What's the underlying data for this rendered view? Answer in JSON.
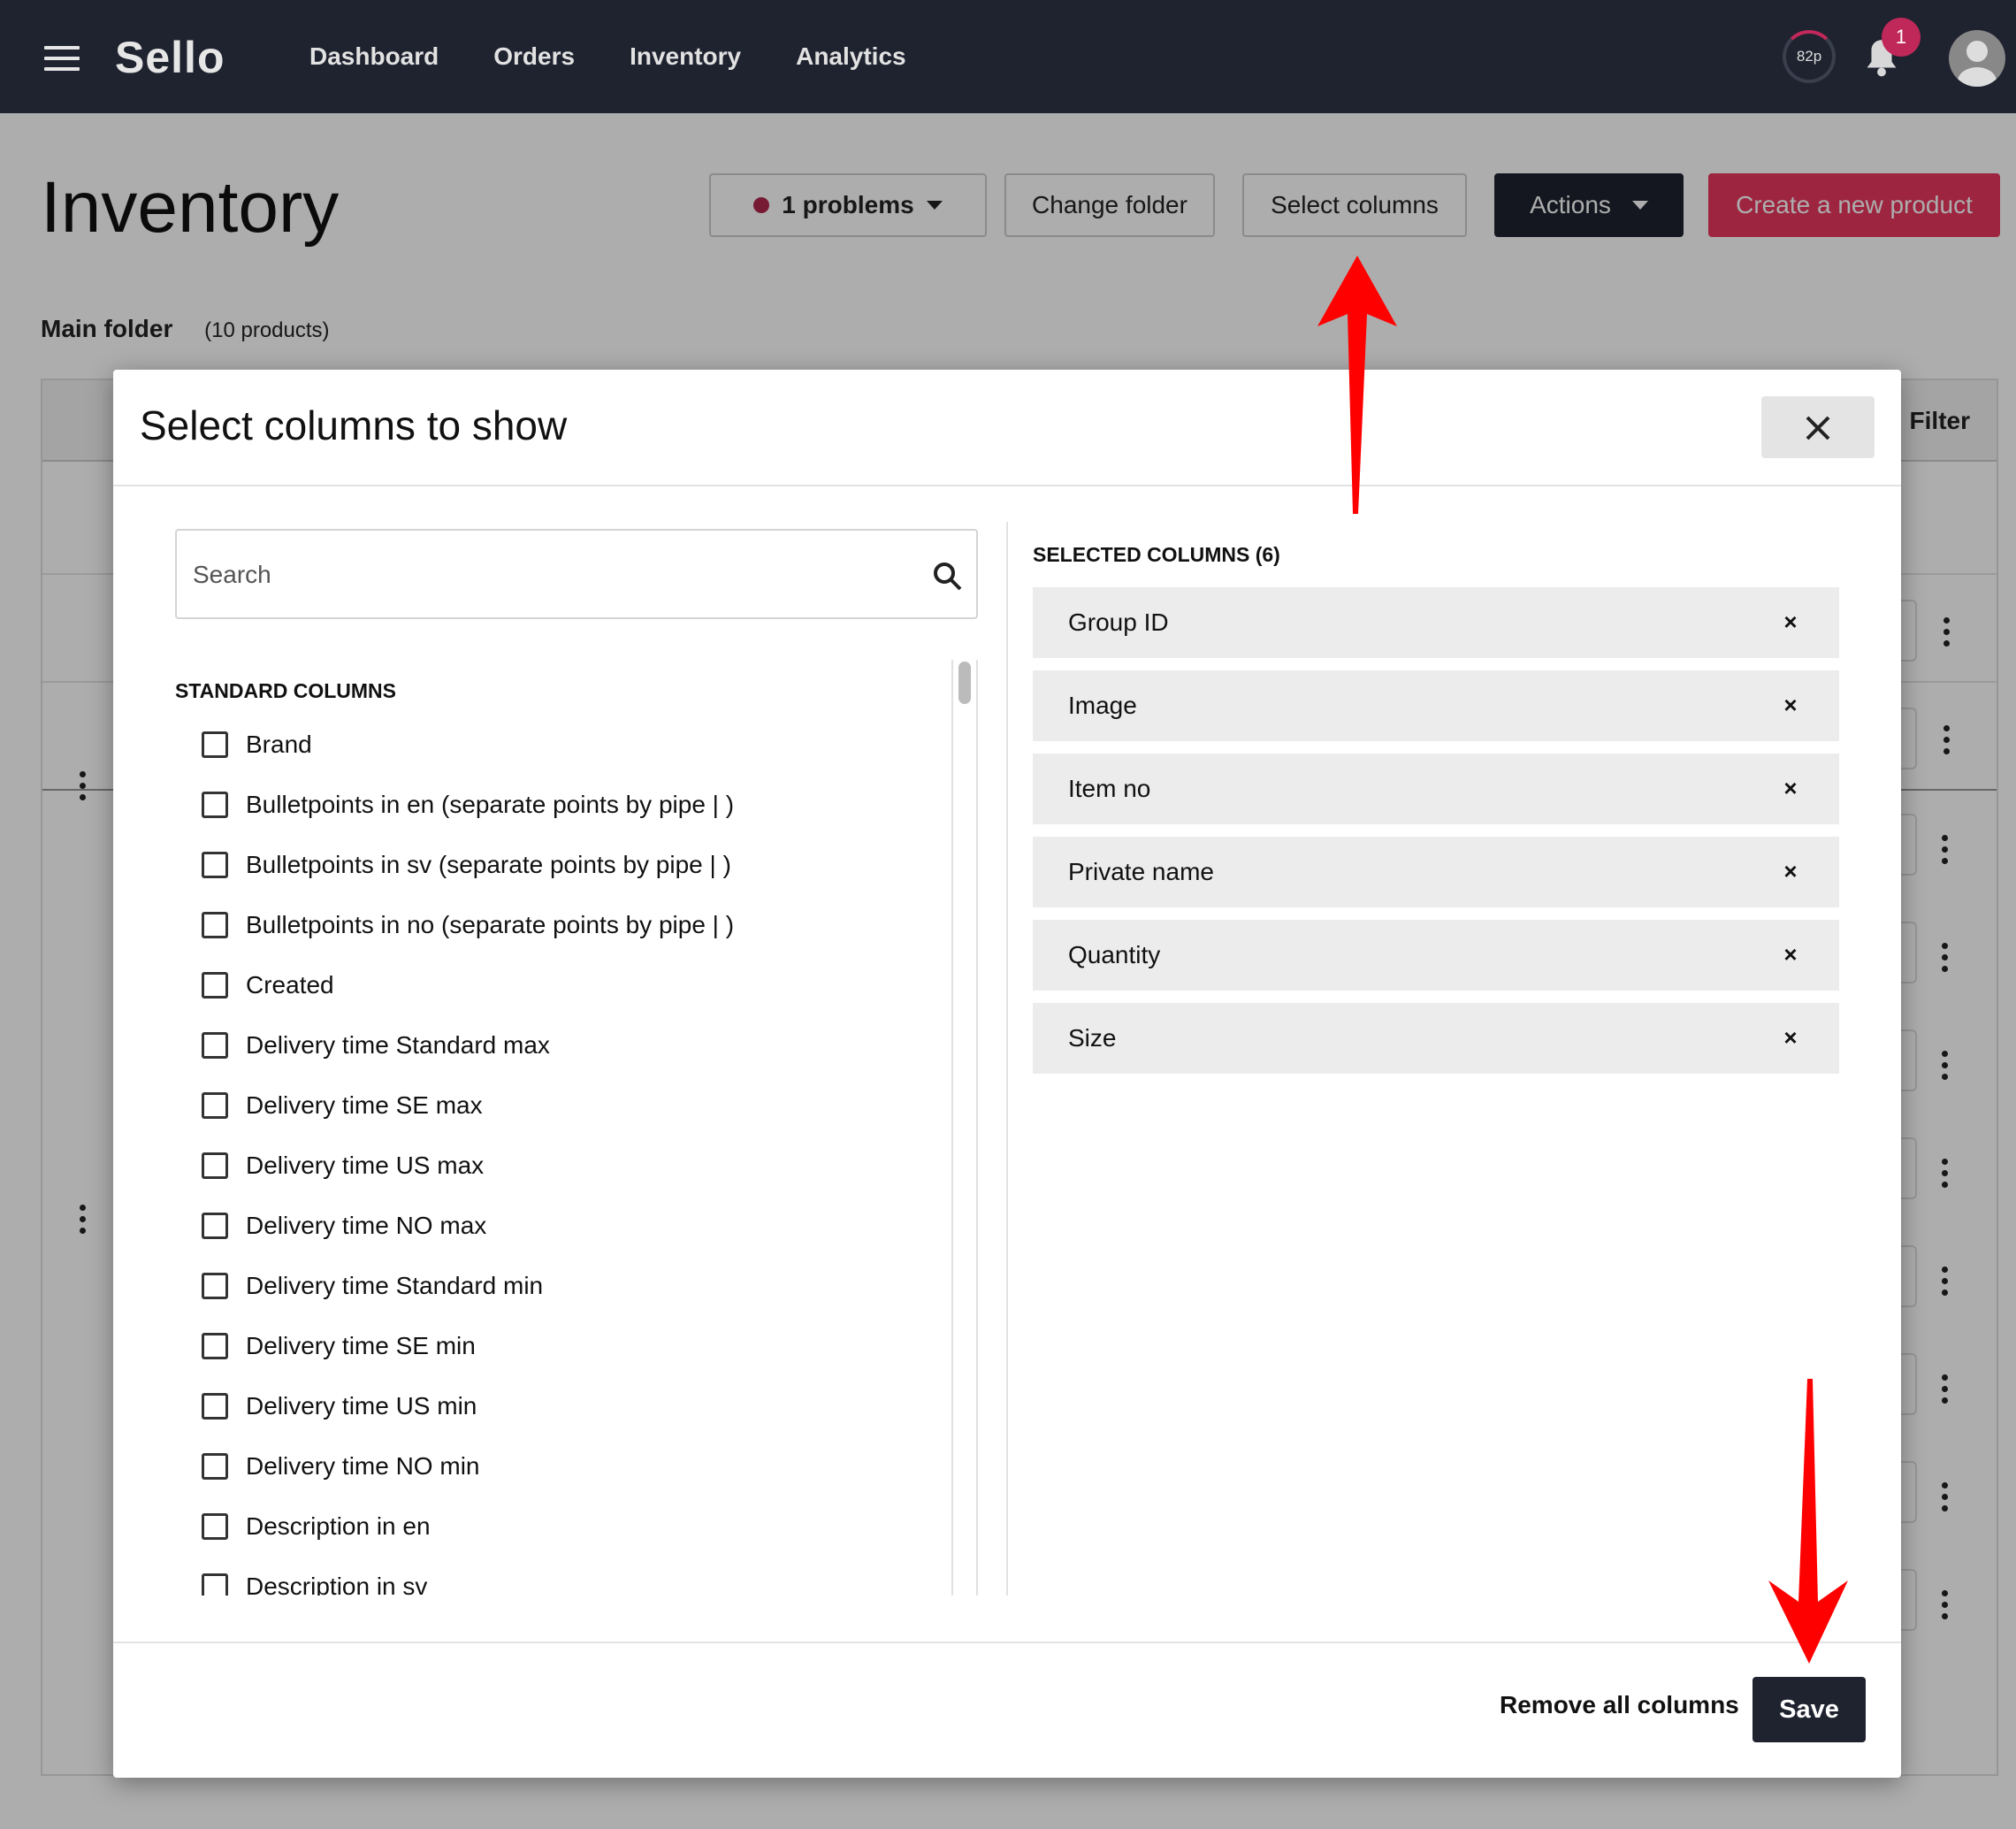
{
  "nav": {
    "logo": "Sello",
    "links": [
      "Dashboard",
      "Orders",
      "Inventory",
      "Analytics"
    ],
    "credit": "82p",
    "notification_count": "1"
  },
  "page": {
    "title": "Inventory",
    "problems_label": "1 problems",
    "change_folder_label": "Change folder",
    "select_columns_label": "Select columns",
    "actions_label": "Actions",
    "create_label": "Create a new product",
    "folder_name": "Main folder",
    "folder_count": "(10 products)",
    "filter_label": "Filter"
  },
  "modal": {
    "title": "Select columns to show",
    "search_placeholder": "Search",
    "standard_heading": "STANDARD COLUMNS",
    "standard_columns": [
      "Brand",
      "Bulletpoints in en (separate points by pipe | )",
      "Bulletpoints in sv (separate points by pipe | )",
      "Bulletpoints in no (separate points by pipe | )",
      "Created",
      "Delivery time Standard max",
      "Delivery time SE max",
      "Delivery time US max",
      "Delivery time NO max",
      "Delivery time Standard min",
      "Delivery time SE min",
      "Delivery time US min",
      "Delivery time NO min",
      "Description in en",
      "Description in sv"
    ],
    "selected_heading": "SELECTED COLUMNS (6)",
    "selected_columns": [
      "Group ID",
      "Image",
      "Item no",
      "Private name",
      "Quantity",
      "Size"
    ],
    "remove_symbol": "×",
    "remove_all_label": "Remove all columns",
    "save_label": "Save"
  },
  "colors": {
    "nav_bg": "#1f2330",
    "accent": "#e8375f",
    "badge": "#c0285a",
    "annotation_arrow": "#ff0000"
  }
}
